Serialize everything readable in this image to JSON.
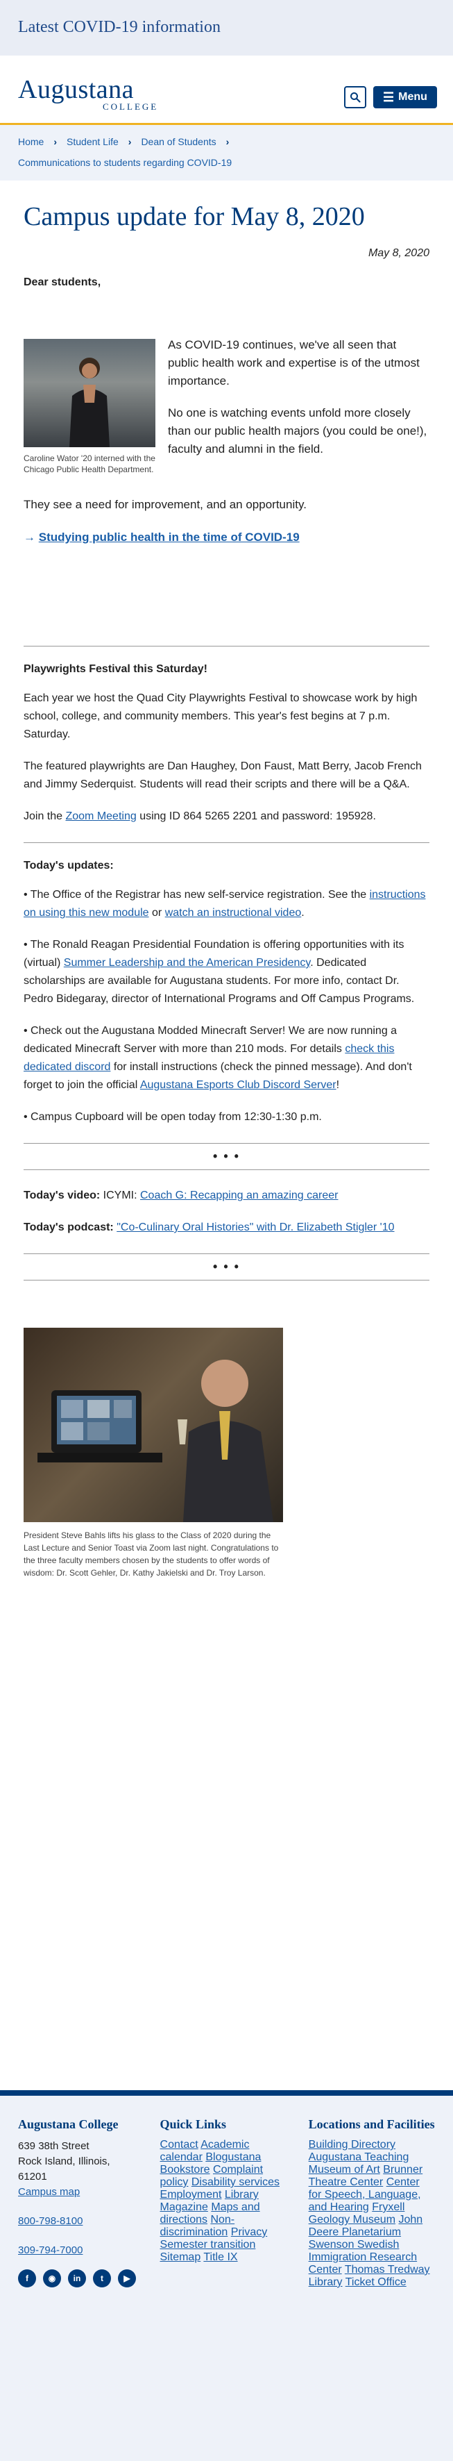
{
  "covid_bar": {
    "text": "Latest COVID-19 information"
  },
  "header": {
    "logo_name": "Augustana",
    "logo_college": "COLLEGE",
    "search_icon": "search-icon",
    "menu_label": "Menu"
  },
  "breadcrumb": {
    "items": [
      "Home",
      "Student Life",
      "Dean of Students"
    ],
    "current": "Communications to students regarding COVID-19"
  },
  "article": {
    "title": "Campus update for May 8, 2020",
    "date": "May 8, 2020",
    "greeting": "Dear students,",
    "photo1_caption": "Caroline Wator '20 interned with the Chicago Public Health Department.",
    "p1": "As COVID-19 continues, we've all seen that public health work and expertise is of the utmost importance.",
    "p2": "No one is watching events unfold more closely than our public health majors (you could be one!), faculty and alumni in the field.",
    "p3": "They see a need for improvement, and an opportunity.",
    "link_arrow": "→",
    "link_text": "Studying public health in the time of COVID-19",
    "playwrights_heading": "Playwrights Festival this Saturday!",
    "playwrights_p1": "Each year we host the Quad City Playwrights Festival to showcase work by high school, college, and community members. This year's fest begins at 7 p.m. Saturday.",
    "playwrights_p2": "The featured playwrights are Dan Haughey, Don Faust, Matt Berry, Jacob French and Jimmy Sederquist. Students will read their scripts and there will be a Q&A.",
    "zoom_pre": "Join the ",
    "zoom_link": "Zoom Meeting",
    "zoom_post": " using ID 864 5265 2201 and password: 195928.",
    "updates_heading": "Today's updates:",
    "u1_pre": "• The Office of the Registrar has new self-service registration. See the ",
    "u1_link1": "instructions on using this new module",
    "u1_mid": " or ",
    "u1_link2": "watch an instructional video",
    "u1_post": ".",
    "u2_pre": "• The Ronald Reagan Presidential Foundation is offering opportunities with its (virtual) ",
    "u2_link": "Summer Leadership and the American Presidency",
    "u2_post": ". Dedicated scholarships are available for Augustana students. For more info, contact Dr. Pedro Bidegaray, director of International Programs and Off Campus Programs.",
    "u3_pre": "• Check out the Augustana Modded Minecraft Server! We are now running a dedicated Minecraft Server with more than 210 mods. For details ",
    "u3_link1": "check this dedicated discord",
    "u3_mid": " for install instructions (check the pinned message). And don't forget to join the official ",
    "u3_link2": "Augustana Esports Club Discord Server",
    "u3_post": "!",
    "u4": "• Campus Cupboard will be open today from 12:30-1:30 p.m.",
    "dots": "• • •",
    "video_label": "Today's video:",
    "video_pre": " ICYMI: ",
    "video_link": "Coach G: Recapping an amazing career",
    "podcast_label": "Today's podcast:",
    "podcast_link": "\"Co-Culinary Oral Histories\" with Dr. Elizabeth Stigler '10",
    "photo2_caption": "President Steve Bahls lifts his glass to the Class of 2020 during the Last Lecture and Senior Toast via Zoom last night. Congratulations to the three faculty members chosen by the students to offer words of wisdom: Dr. Scott Gehler, Dr. Kathy Jakielski and Dr. Troy Larson."
  },
  "footer": {
    "college": {
      "heading": "Augustana College",
      "address1": "639 38th Street",
      "address2": "Rock Island, Illinois,",
      "address3": "61201",
      "map_link": "Campus map",
      "phone1": "800-798-8100",
      "phone2": "309-794-7000"
    },
    "social": [
      "facebook-icon",
      "instagram-icon",
      "linkedin-icon",
      "twitter-icon",
      "youtube-icon"
    ],
    "quick_links": {
      "heading": "Quick Links",
      "items": [
        "Contact",
        "Academic calendar",
        "Blogustana",
        "Bookstore",
        "Complaint policy",
        "Disability services",
        "Employment",
        "Library",
        "Magazine",
        "Maps and directions",
        "Non-discrimination",
        "Privacy",
        "Semester transition",
        "Sitemap",
        "Title IX"
      ]
    },
    "locations": {
      "heading": "Locations and Facilities",
      "items": [
        "Building Directory",
        "Augustana Teaching Museum of Art",
        "Brunner Theatre Center",
        "Center for Speech, Language, and Hearing",
        "Fryxell Geology Museum",
        "John Deere Planetarium",
        "Swenson Swedish Immigration Research Center",
        "Thomas Tredway Library",
        "Ticket Office"
      ]
    }
  }
}
